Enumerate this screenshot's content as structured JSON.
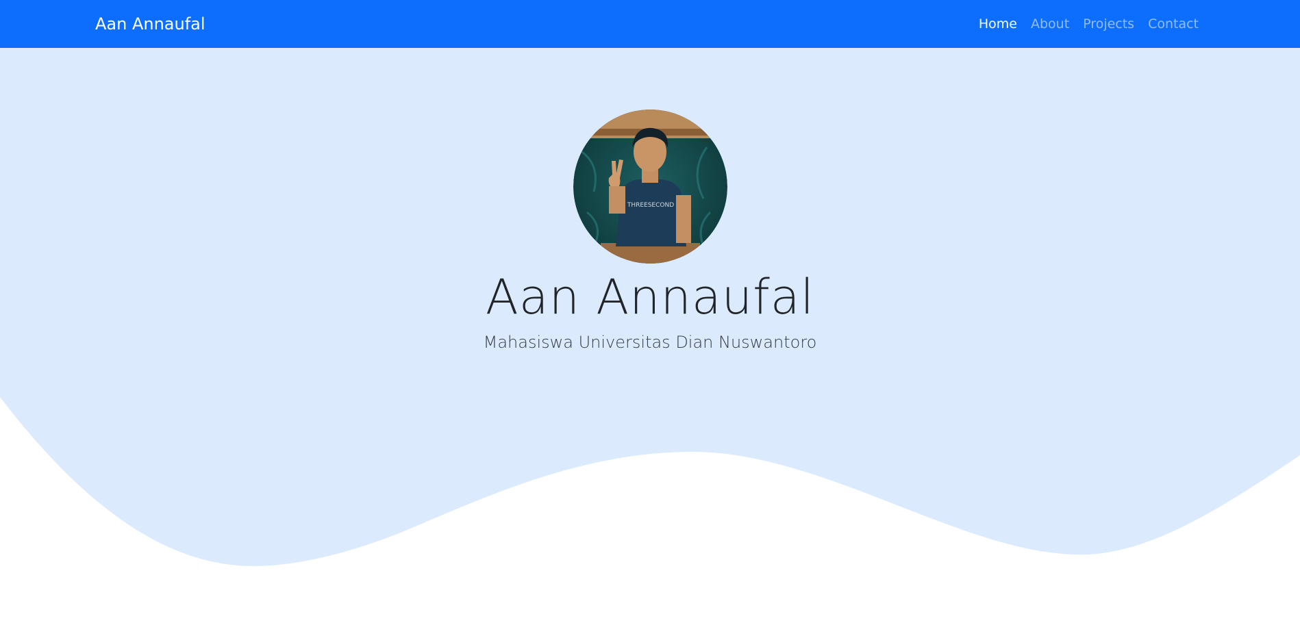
{
  "navbar": {
    "brand": "Aan Annaufal",
    "links": [
      {
        "label": "Home",
        "active": true
      },
      {
        "label": "About",
        "active": false
      },
      {
        "label": "Projects",
        "active": false
      },
      {
        "label": "Contact",
        "active": false
      }
    ]
  },
  "hero": {
    "name": "Aan Annaufal",
    "tagline": "Mahasiswa Universitas Dian Nuswantoro",
    "shirt_print": "THREESECOND"
  },
  "colors": {
    "navbar": "#0d6efd",
    "hero_background": "#dbebfd",
    "page_background": "#ffffff"
  }
}
